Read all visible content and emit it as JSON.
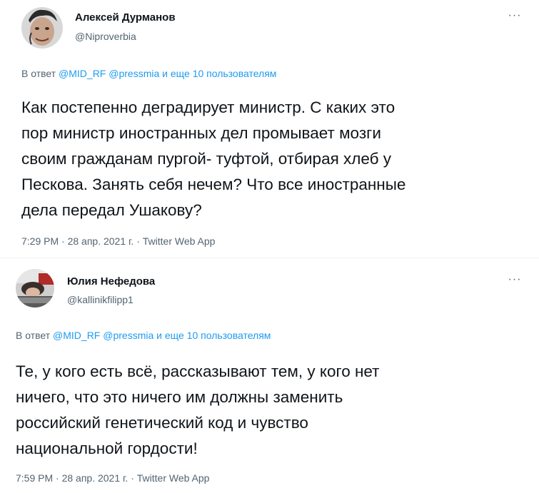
{
  "tweets": [
    {
      "author_name": "Алексей Дурманов",
      "author_handle": "@Niproverbia",
      "reply_prefix": "В ответ",
      "mentions": [
        "@MID_RF",
        "@pressmia"
      ],
      "others": "и еще 10 пользователям",
      "text_lines": [
        "Как постепенно деградирует министр. С каких это",
        "пор министр иностранных дел промывает мозги",
        "своим гражданам пургой- туфтой, отбирая хлеб у",
        "Пескова. Занять себя нечем? Что все иностранные",
        "дела передал Ушакову?"
      ],
      "time": "7:29 PM",
      "date": "28 апр. 2021 г.",
      "source": "Twitter Web App",
      "more": "···"
    },
    {
      "author_name": "Юлия Нефедова",
      "author_handle": "@kallinikfilipp1",
      "reply_prefix": "В ответ",
      "mentions": [
        "@MID_RF",
        "@pressmia"
      ],
      "others": "и еще 10 пользователям",
      "text_lines": [
        "Те, у кого есть всё, рассказывают тем, у кого нет",
        "ничего, что это ничего им должны заменить",
        "российский генетический код и чувство",
        "национальной гордости!"
      ],
      "time": "7:59 PM",
      "date": "28 апр. 2021 г.",
      "source": "Twitter Web App",
      "more": "···"
    }
  ],
  "separator": "·",
  "colors": {
    "text": "#0f1419",
    "secondary": "#536471",
    "link": "#1d9bf0",
    "divider": "#eff3f4"
  }
}
